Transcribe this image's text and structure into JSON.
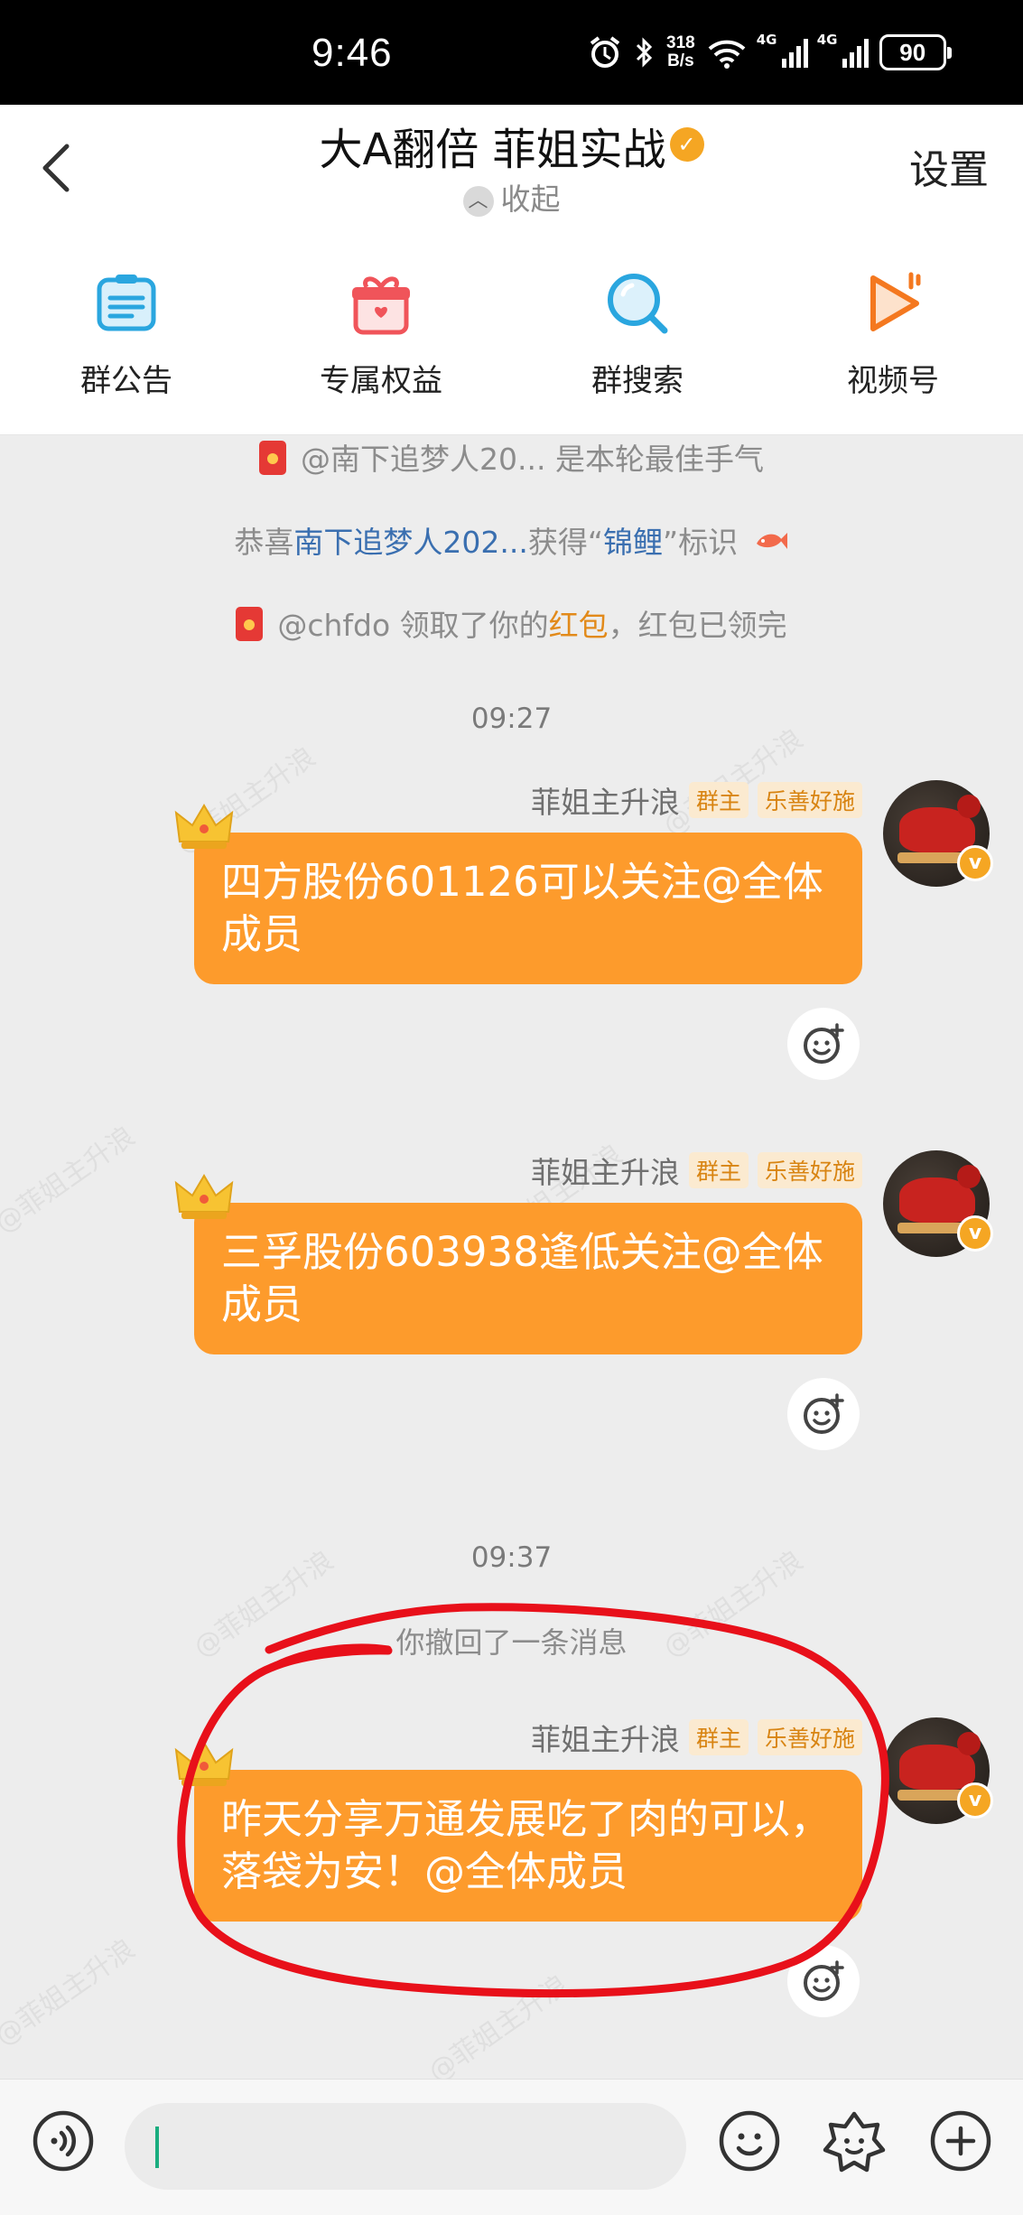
{
  "status_bar": {
    "time": "9:46",
    "net_speed_top": "318",
    "net_speed_bottom": "B/s",
    "signal1": "4G",
    "signal2": "4G",
    "battery": "90"
  },
  "header": {
    "title": "大A翻倍  菲姐实战",
    "collapse_label": "收起",
    "settings_label": "设置",
    "tools": [
      {
        "label": "群公告",
        "icon": "announcement-icon"
      },
      {
        "label": "专属权益",
        "icon": "gift-icon"
      },
      {
        "label": "群搜索",
        "icon": "search-icon"
      },
      {
        "label": "视频号",
        "icon": "video-channel-icon"
      }
    ]
  },
  "chat": {
    "system": {
      "best_luck": "@南下追梦人20... 是本轮最佳手气",
      "congrats_prefix": "恭喜",
      "congrats_name": "南下追梦人202...",
      "congrats_mid": "获得“",
      "congrats_badge": "锦鲤",
      "congrats_suffix": "”标识",
      "redpacket_prefix": "@chfdo 领取了你的",
      "redpacket_word": "红包",
      "redpacket_suffix": "，红包已领完"
    },
    "timestamps": [
      "09:27",
      "09:37"
    ],
    "sender_name": "菲姐主升浪",
    "tag_owner": "群主",
    "tag_title": "乐善好施",
    "messages": [
      "四方股份601126可以关注@全体成员",
      "三孚股份603938逢低关注@全体成员",
      "昨天分享万通发展吃了肉的可以，落袋为安！@全体成员"
    ],
    "retracted_notice": "你撤回了一条消息",
    "watermark": "@菲姐主升浪"
  },
  "colors": {
    "bubble": "#fd9b2c",
    "accent_orange": "#f5a623",
    "link_blue": "#3a6fb0",
    "annotation_red": "#e8101a"
  }
}
